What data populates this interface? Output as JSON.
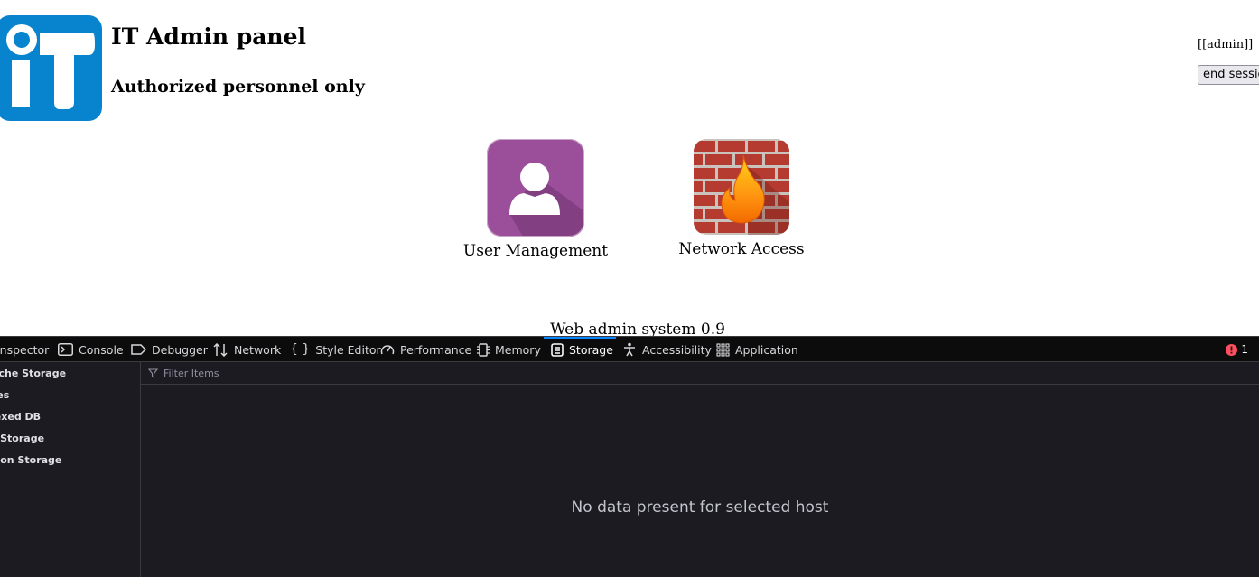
{
  "page": {
    "title": "IT Admin panel",
    "subtitle": "Authorized personnel only",
    "user_tag": "[[admin]]",
    "end_session_label": "end session",
    "apps": [
      {
        "label": "User Management",
        "icon": "user-icon"
      },
      {
        "label": "Network Access",
        "icon": "firewall-icon"
      }
    ],
    "footer": "Web admin system 0.9"
  },
  "devtools": {
    "tabs": [
      {
        "label": "Inspector",
        "icon": "inspector-icon"
      },
      {
        "label": "Console",
        "icon": "console-icon"
      },
      {
        "label": "Debugger",
        "icon": "debugger-icon"
      },
      {
        "label": "Network",
        "icon": "network-icon"
      },
      {
        "label": "Style Editor",
        "icon": "style-editor-icon"
      },
      {
        "label": "Performance",
        "icon": "performance-icon"
      },
      {
        "label": "Memory",
        "icon": "memory-icon"
      },
      {
        "label": "Storage",
        "icon": "storage-icon",
        "selected": true
      },
      {
        "label": "Accessibility",
        "icon": "accessibility-icon"
      },
      {
        "label": "Application",
        "icon": "application-icon"
      }
    ],
    "error_count": "1",
    "sidebar": [
      "Cache Storage",
      "Cookies",
      "Indexed DB",
      "Local Storage",
      "Session Storage"
    ],
    "filter_placeholder": "Filter Items",
    "empty_message": "No data present for selected host"
  },
  "colors": {
    "logo_blue": "#0884cf",
    "user_tile": "#9b4f9b",
    "devtools_bg": "#1c1b22",
    "selected_tab_accent": "#0a84ff"
  }
}
